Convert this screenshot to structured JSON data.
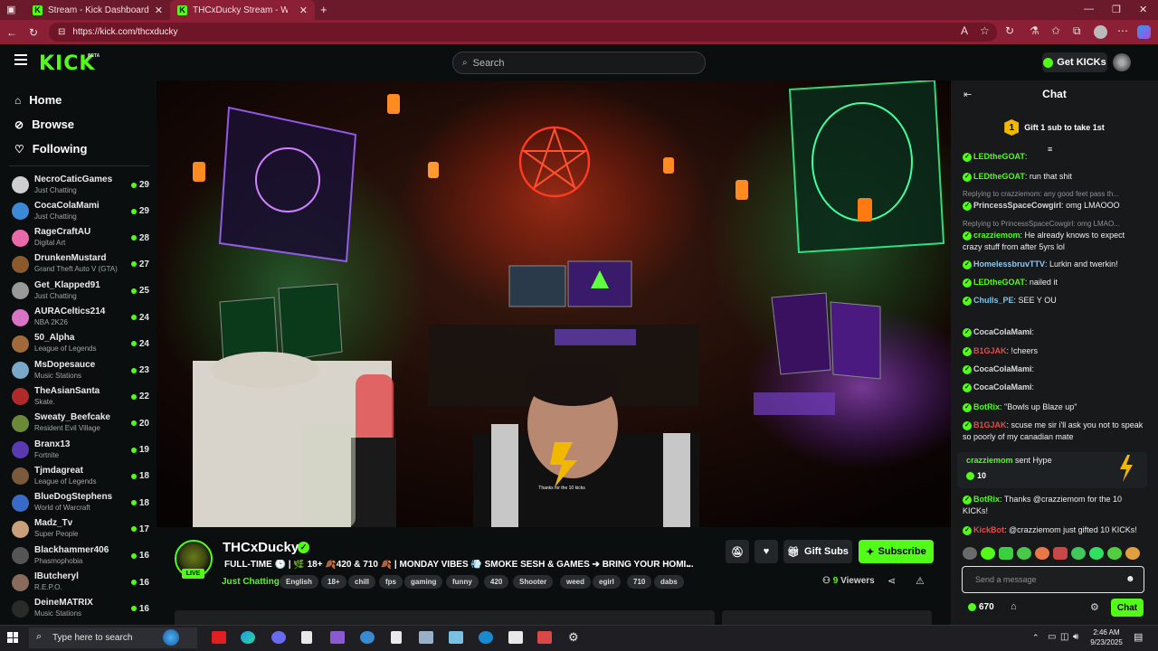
{
  "browser": {
    "tabs": [
      {
        "title": "Stream - Kick Dashboard"
      },
      {
        "title": "THCxDucky Stream - Watch"
      }
    ],
    "url": "https://kick.com/thcxducky"
  },
  "header": {
    "logo": "KICK",
    "beta": "BETA",
    "search_placeholder": "Search",
    "get_kicks": "Get KICKs"
  },
  "sidebar": {
    "nav": [
      {
        "label": "Home",
        "icon": "home-icon"
      },
      {
        "label": "Browse",
        "icon": "compass-icon"
      },
      {
        "label": "Following",
        "icon": "heart-icon"
      }
    ],
    "channels": [
      {
        "name": "NecroCatiсGames",
        "category": "Just Chatting",
        "viewers": "29",
        "color": "#cfcfcf"
      },
      {
        "name": "CocaColaMami",
        "category": "Just Chatting",
        "viewers": "29",
        "color": "#3a8ad8"
      },
      {
        "name": "RageCraftAU",
        "category": "Digital Art",
        "viewers": "28",
        "color": "#e96aa8"
      },
      {
        "name": "DrunkenMustard",
        "category": "Grand Theft Auto V (GTA)",
        "viewers": "27",
        "color": "#8a5a2a"
      },
      {
        "name": "Get_Klapped91",
        "category": "Just Chatting",
        "viewers": "25",
        "color": "#999999"
      },
      {
        "name": "AURACeltics214",
        "category": "NBA 2K26",
        "viewers": "24",
        "color": "#d873c6"
      },
      {
        "name": "50_Alpha",
        "category": "League of Legends",
        "viewers": "24",
        "color": "#a06a3a"
      },
      {
        "name": "MsDopesauce",
        "category": "Music Stations",
        "viewers": "23",
        "color": "#7aa8c8"
      },
      {
        "name": "TheAsianSanta",
        "category": "Skate.",
        "viewers": "22",
        "color": "#b02a2a"
      },
      {
        "name": "Sweaty_Beefcake",
        "category": "Resident Evil Village",
        "viewers": "20",
        "color": "#6a8a3a"
      },
      {
        "name": "Branx13",
        "category": "Fortnite",
        "viewers": "19",
        "color": "#5a3ab0"
      },
      {
        "name": "Tjmdagreat",
        "category": "League of Legends",
        "viewers": "18",
        "color": "#7a5a3a"
      },
      {
        "name": "BlueDogStephens",
        "category": "World of Warcraft",
        "viewers": "18",
        "color": "#3a6ac8"
      },
      {
        "name": "Madz_Tv",
        "category": "Super People",
        "viewers": "17",
        "color": "#c8a07a"
      },
      {
        "name": "Blackhammer406",
        "category": "Phasmophobia",
        "viewers": "16",
        "color": "#555555"
      },
      {
        "name": "IButcheryl",
        "category": "R.E.P.O.",
        "viewers": "16",
        "color": "#8a6a5a"
      },
      {
        "name": "DeineMATRIX",
        "category": "Music Stations",
        "viewers": "16",
        "color": "#2a2a2a"
      }
    ]
  },
  "stream": {
    "name": "THCxDucky",
    "live": "LIVE",
    "title": "FULL-TIME 🕒 | 🌿 18+ 🍂420 & 710 🍂 | MONDAY VIBES 💨 SMOKE SESH & GAMES ➔ BRING YOUR HOMI...",
    "category": "Just Chatting",
    "tags": [
      "English",
      "18+",
      "chill",
      "fps",
      "gaming",
      "funny",
      "420",
      "Shooter",
      "weed",
      "egirl",
      "710",
      "dabs"
    ],
    "viewers_count": "9",
    "viewers_label": "Viewers",
    "gift_subs": "Gift Subs",
    "subscribe": "Subscribe",
    "video_caption": "Thanks for the 10 kicks"
  },
  "chat": {
    "title": "Chat",
    "gift_prompt": "Gift 1 sub to take 1st",
    "gift_rank": "1",
    "messages": [
      {
        "user": "LEDtheGOAT",
        "text": "",
        "color": "#53fc18"
      },
      {
        "user": "LEDtheGOAT",
        "text": "run that shit",
        "color": "#53fc18"
      },
      {
        "reply": "Replying to crazziemom: any good feet pass th...",
        "user": "PrincessSpaceCowgirl",
        "text": "omg LMAOOO",
        "color": "#d9d9d9"
      },
      {
        "reply": "Replying to PrincessSpaceCowgirl: omg LMAO...",
        "user": "crazziemom",
        "text": "He already knows to expect crazy stuff from after 5yrs lol",
        "color": "#53fc18"
      },
      {
        "user": "HomelessbruvTTV",
        "text": "Lurkin and twerkin!",
        "color": "#8fc8f0"
      },
      {
        "user": "LEDtheGOAT",
        "text": "nailed it",
        "color": "#53fc18"
      },
      {
        "user": "Chulls_PE",
        "text": "SEE Y OU",
        "color": "#7ac8f0"
      },
      {
        "user": "CocaColaMami",
        "text": "",
        "color": "#d9d9d9"
      },
      {
        "user": "B1GJAK",
        "text": "!cheers",
        "color": "#e84a4a"
      },
      {
        "user": "CocaColaMami",
        "text": "",
        "color": "#d9d9d9"
      },
      {
        "user": "CocaColaMami",
        "text": "",
        "color": "#d9d9d9"
      },
      {
        "user": "BotRix",
        "text": "\"Bowls up Blaze up\"",
        "color": "#53fc18"
      },
      {
        "user": "B1GJAK",
        "text": "scuse me sir i'll ask you not to speak so poorly of my canadian mate",
        "color": "#e84a4a"
      },
      {
        "user": "BotRix",
        "text": "Thanks @crazziemom for the 10 KICKs!",
        "color": "#53fc18"
      },
      {
        "user": "KickBot",
        "text": "@crazziemom just gifted 10 KICKs!",
        "color": "#e84a4a"
      }
    ],
    "hype": {
      "user": "crazziemom",
      "action": "sent Hype",
      "amount": "10"
    },
    "input_placeholder": "Send a message",
    "kicks_balance": "670",
    "send_label": "Chat"
  },
  "taskbar": {
    "search_placeholder": "Type here to search",
    "time": "2:46 AM",
    "date": "9/23/2025"
  }
}
